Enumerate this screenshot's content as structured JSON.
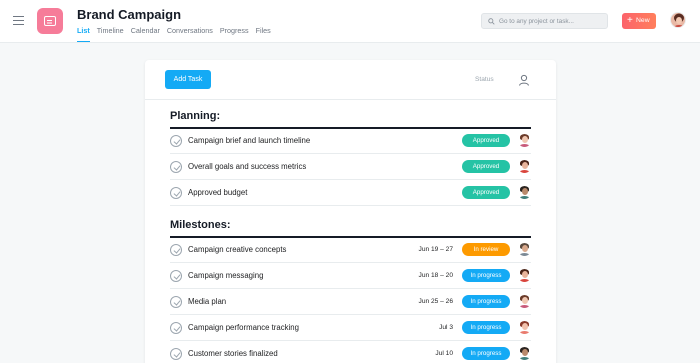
{
  "header": {
    "project_title": "Brand Campaign",
    "tabs": [
      {
        "label": "List",
        "active": true
      },
      {
        "label": "Timeline",
        "active": false
      },
      {
        "label": "Calendar",
        "active": false
      },
      {
        "label": "Conversations",
        "active": false
      },
      {
        "label": "Progress",
        "active": false
      },
      {
        "label": "Files",
        "active": false
      }
    ],
    "search_placeholder": "Go to any project or task...",
    "new_button_label": "New",
    "accent_color": "#14aaf5",
    "project_icon_color": "#f67c99"
  },
  "toolbar": {
    "add_task_label": "Add Task",
    "status_label": "Status"
  },
  "sections": [
    {
      "title": "Planning:",
      "tasks": [
        {
          "name": "Campaign brief and launch timeline",
          "due": "",
          "status": "Approved",
          "status_type": "approved",
          "avatar": "woman-a"
        },
        {
          "name": "Overall goals and success metrics",
          "due": "",
          "status": "Approved",
          "status_type": "approved",
          "avatar": "woman-b"
        },
        {
          "name": "Approved budget",
          "due": "",
          "status": "Approved",
          "status_type": "approved",
          "avatar": "man-a"
        }
      ]
    },
    {
      "title": "Milestones:",
      "tasks": [
        {
          "name": "Campaign creative concepts",
          "due": "Jun 19 – 27",
          "status": "In review",
          "status_type": "review",
          "avatar": "man-b"
        },
        {
          "name": "Campaign messaging",
          "due": "Jun 18 – 20",
          "status": "In progress",
          "status_type": "progress",
          "avatar": "woman-b"
        },
        {
          "name": "Media plan",
          "due": "Jun 25 – 26",
          "status": "In progress",
          "status_type": "progress",
          "avatar": "woman-a"
        },
        {
          "name": "Campaign performance tracking",
          "due": "Jul 3",
          "status": "In progress",
          "status_type": "progress",
          "avatar": "woman-c"
        },
        {
          "name": "Customer stories finalized",
          "due": "Jul 10",
          "status": "In progress",
          "status_type": "progress",
          "avatar": "man-a"
        }
      ]
    }
  ],
  "status_colors": {
    "approved": "#25c3a5",
    "review": "#fd9a00",
    "progress": "#14aaf5"
  }
}
